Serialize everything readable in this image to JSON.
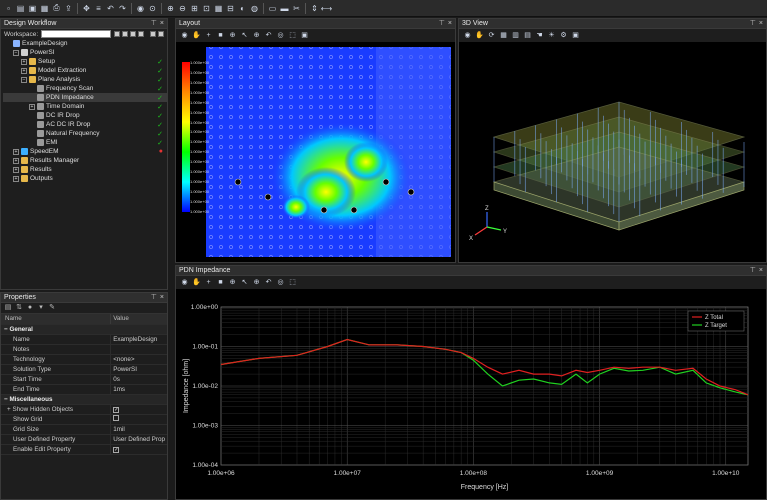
{
  "toolbar": {
    "icons": [
      "new-icon",
      "open-icon",
      "save-icon",
      "save-all-icon",
      "print-icon",
      "export-icon",
      "route-icon",
      "layers-icon",
      "undo-icon",
      "redo-icon",
      "zoom-options-icon",
      "snap-icon",
      "zoom-in-icon",
      "zoom-out-icon",
      "zoom-window-icon",
      "zoom-fit-icon",
      "grid-icon",
      "measure-icon",
      "highlight-icon",
      "select-icon",
      "net-icon",
      "pan-icon",
      "cross-probe-icon",
      "flip-icon",
      "move-icon"
    ]
  },
  "design_workflow": {
    "title": "Design Workflow",
    "workspace_label": "Workspace:",
    "tree": [
      {
        "label": "ExampleDesign",
        "level": 0,
        "icon": "design-icon",
        "expander": "",
        "status": ""
      },
      {
        "label": "PowerSI",
        "level": 1,
        "icon": "powersi-icon",
        "expander": "−",
        "status": ""
      },
      {
        "label": "Setup",
        "level": 2,
        "icon": "folder-icon",
        "expander": "+",
        "status": "check"
      },
      {
        "label": "Model Extraction",
        "level": 2,
        "icon": "folder-icon",
        "expander": "+",
        "status": "check"
      },
      {
        "label": "Plane Analysis",
        "level": 2,
        "icon": "folder-icon",
        "expander": "−",
        "status": "check"
      },
      {
        "label": "Frequency Scan",
        "level": 3,
        "icon": "task-icon",
        "expander": "",
        "status": "check"
      },
      {
        "label": "PDN Impedance",
        "level": 3,
        "icon": "task-icon",
        "expander": "",
        "status": "check",
        "selected": true
      },
      {
        "label": "Time Domain",
        "level": 3,
        "icon": "task-icon",
        "expander": "+",
        "status": "check"
      },
      {
        "label": "DC IR Drop",
        "level": 3,
        "icon": "task-icon",
        "expander": "",
        "status": "check"
      },
      {
        "label": "AC DC IR Drop",
        "level": 3,
        "icon": "task-icon",
        "expander": "",
        "status": "check"
      },
      {
        "label": "Natural Frequency",
        "level": 3,
        "icon": "task-icon",
        "expander": "",
        "status": "check"
      },
      {
        "label": "EMI",
        "level": 3,
        "icon": "task-icon",
        "expander": "",
        "status": "check"
      },
      {
        "label": "SpeedEM",
        "level": 1,
        "icon": "speedem-icon",
        "expander": "+",
        "status": "cross"
      },
      {
        "label": "Results Manager",
        "level": 1,
        "icon": "folder-icon",
        "expander": "+",
        "status": ""
      },
      {
        "label": "Results",
        "level": 1,
        "icon": "folder-icon",
        "expander": "+",
        "status": ""
      },
      {
        "label": "Outputs",
        "level": 1,
        "icon": "folder-icon",
        "expander": "+",
        "status": ""
      }
    ]
  },
  "properties": {
    "title": "Properties",
    "col_name": "Name",
    "col_value": "Value",
    "categories": [
      {
        "name": "General",
        "rows": [
          {
            "name": "Name",
            "value": "ExampleDesign",
            "type": "text"
          },
          {
            "name": "Notes",
            "value": "",
            "type": "text"
          },
          {
            "name": "Technology",
            "value": "<none>",
            "type": "text"
          },
          {
            "name": "Solution Type",
            "value": "PowerSI",
            "type": "text"
          },
          {
            "name": "Start Time",
            "value": "0s",
            "type": "text"
          },
          {
            "name": "End Time",
            "value": "1ms",
            "type": "text"
          }
        ]
      },
      {
        "name": "Miscellaneous",
        "rows": [
          {
            "name": "Show Hidden Objects",
            "value": "✓",
            "type": "check",
            "expander": "+"
          },
          {
            "name": "Show Grid",
            "value": "",
            "type": "check"
          },
          {
            "name": "Grid Size",
            "value": "1mil",
            "type": "text"
          },
          {
            "name": "User Defined Property",
            "value": "User Defined Prop",
            "type": "text"
          },
          {
            "name": "Enable Edit Property",
            "value": "✓",
            "type": "check"
          }
        ]
      }
    ]
  },
  "layout_panel": {
    "title": "Layout",
    "legend_labels": [
      "1.000e+00",
      "1.000e+00",
      "1.000e+00",
      "1.000e+00",
      "1.000e+00",
      "1.000e+00",
      "1.000e+00",
      "1.000e+00",
      "1.000e+00",
      "1.000e+00",
      "1.000e+00",
      "1.000e+00",
      "1.000e+00",
      "1.000e+00",
      "1.000e+00",
      "1.000e+00"
    ]
  },
  "view3d_panel": {
    "title": "3D View",
    "axes": {
      "z": "Z",
      "y": "Y",
      "x": "X"
    }
  },
  "pdn_panel": {
    "title": "PDN Impedance"
  },
  "colors": {
    "accent": "#4da3ff",
    "ztotal": "#e02020",
    "ztarget": "#20d020",
    "check": "#1ec41e",
    "cross": "#e33333"
  },
  "chart_data": {
    "type": "line",
    "xlabel": "Frequency [Hz]",
    "ylabel": "Impedance [ohm]",
    "x_scale": "log",
    "y_scale": "log",
    "xlim": [
      1000000,
      15000000000
    ],
    "ylim": [
      0.0001,
      1.0
    ],
    "x_ticks": [
      {
        "value": 1000000,
        "label": "1.00e+06"
      },
      {
        "value": 10000000,
        "label": "1.00e+07"
      },
      {
        "value": 100000000,
        "label": "1.00e+08"
      },
      {
        "value": 1000000000,
        "label": "1.00e+09"
      },
      {
        "value": 10000000000,
        "label": "1.00e+10"
      }
    ],
    "y_ticks": [
      {
        "value": 1.0,
        "label": "1.00e+00"
      },
      {
        "value": 0.1,
        "label": "1.00e-01"
      },
      {
        "value": 0.01,
        "label": "1.00e-02"
      },
      {
        "value": 0.001,
        "label": "1.00e-03"
      },
      {
        "value": 0.0001,
        "label": "1.00e-04"
      }
    ],
    "grid": true,
    "legend": "top-right",
    "series": [
      {
        "name": "Z Total",
        "color": "#e02020",
        "x": [
          1000000,
          2000000,
          4000000,
          7000000,
          10000000,
          15000000,
          25000000,
          40000000,
          60000000,
          80000000,
          100000000,
          130000000,
          170000000,
          230000000,
          300000000,
          400000000,
          500000000,
          650000000,
          800000000,
          1000000000,
          1300000000,
          1700000000,
          2200000000,
          3000000000,
          4000000000,
          5500000000,
          7000000000,
          9000000000,
          12000000000,
          15000000000
        ],
        "y": [
          0.035,
          0.05,
          0.06,
          0.1,
          0.15,
          0.11,
          0.11,
          0.1,
          0.085,
          0.07,
          0.05,
          0.03,
          0.02,
          0.025,
          0.02,
          0.02,
          0.018,
          0.025,
          0.022,
          0.025,
          0.03,
          0.028,
          0.03,
          0.03,
          0.025,
          0.028,
          0.015,
          0.01,
          0.008,
          0.006
        ]
      },
      {
        "name": "Z Target",
        "color": "#20d020",
        "x": [
          1000000,
          2000000,
          4000000,
          7000000,
          10000000,
          15000000,
          25000000,
          40000000,
          60000000,
          80000000,
          100000000,
          130000000,
          170000000,
          230000000,
          300000000,
          400000000,
          500000000,
          650000000,
          800000000,
          1000000000,
          1300000000,
          1700000000,
          2200000000,
          3000000000,
          4000000000,
          5500000000,
          7000000000,
          9000000000,
          12000000000,
          15000000000
        ],
        "y": [
          0.035,
          0.05,
          0.06,
          0.1,
          0.15,
          0.11,
          0.11,
          0.1,
          0.085,
          0.07,
          0.045,
          0.02,
          0.01,
          0.014,
          0.015,
          0.012,
          0.011,
          0.02,
          0.012,
          0.02,
          0.028,
          0.024,
          0.025,
          0.03,
          0.02,
          0.025,
          0.012,
          0.009,
          0.007,
          0.006
        ]
      }
    ]
  }
}
